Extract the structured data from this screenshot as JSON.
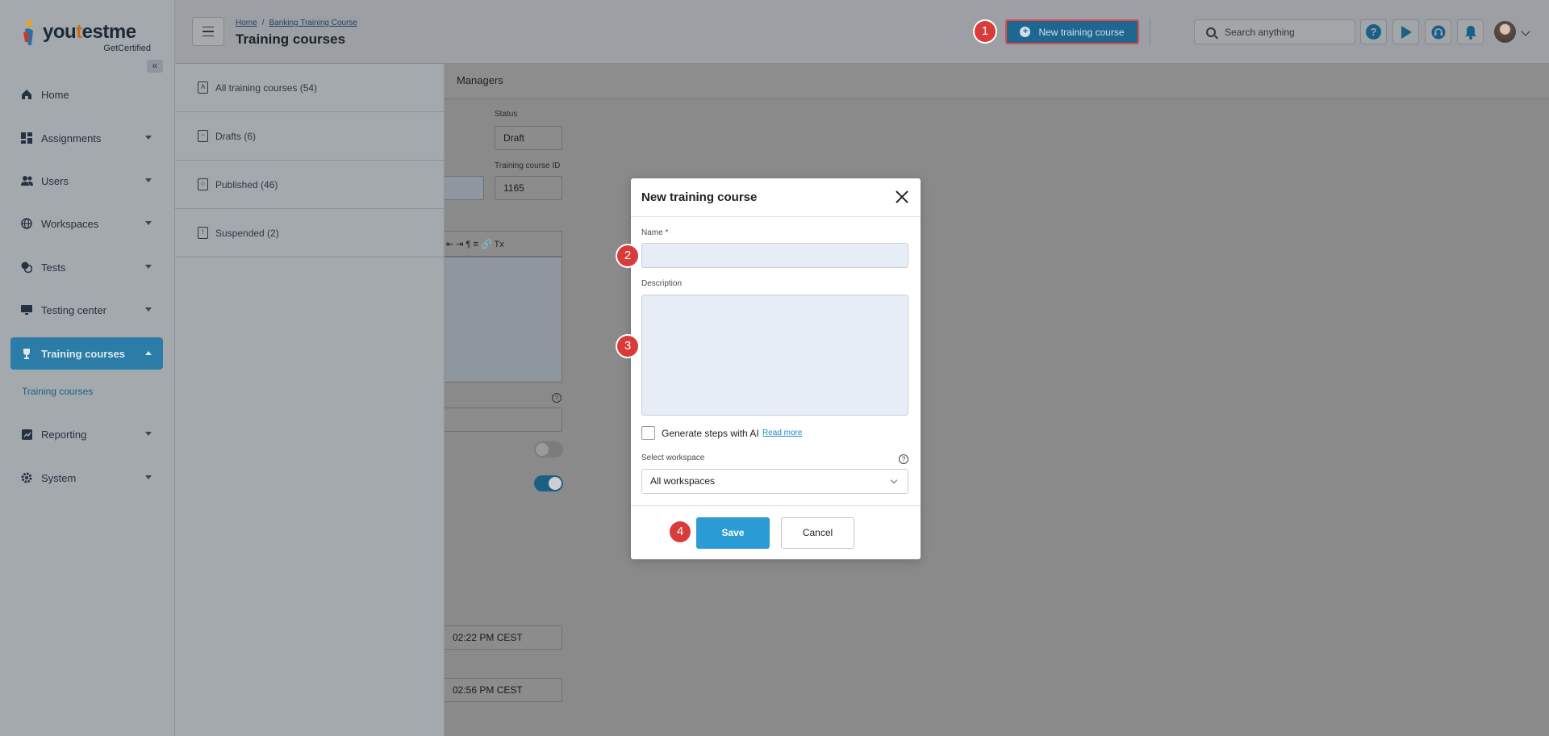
{
  "brand": {
    "name_part1": "you",
    "name_part2": "t",
    "name_part3": "estme",
    "tagline": "GetCertified"
  },
  "sidebar": {
    "collapse_glyph": "«",
    "items": [
      {
        "label": "Home",
        "icon": "home-icon"
      },
      {
        "label": "Assignments",
        "icon": "dashboard-icon"
      },
      {
        "label": "Users",
        "icon": "users-icon"
      },
      {
        "label": "Workspaces",
        "icon": "globe-icon"
      },
      {
        "label": "Tests",
        "icon": "tests-icon"
      },
      {
        "label": "Testing center",
        "icon": "monitor-icon"
      },
      {
        "label": "Training courses",
        "icon": "trophy-icon"
      },
      {
        "label": "Reporting",
        "icon": "chart-icon"
      },
      {
        "label": "System",
        "icon": "gear-icon"
      }
    ],
    "sub_item": "Training courses"
  },
  "header": {
    "breadcrumb_home": "Home",
    "breadcrumb_sep": "/",
    "breadcrumb_course": "Banking Training Course",
    "title": "Training courses",
    "new_button": "New training course",
    "search_placeholder": "Search anything",
    "help_glyph": "?"
  },
  "panel": {
    "items": [
      {
        "label": "All training courses (54)",
        "glyph": "A"
      },
      {
        "label": "Drafts (6)",
        "glyph": "~"
      },
      {
        "label": "Published (46)",
        "glyph": "☆"
      },
      {
        "label": "Suspended (2)",
        "glyph": "!"
      }
    ]
  },
  "background": {
    "tab_managers": "Managers",
    "status_label": "Status",
    "status_value": "Draft",
    "course_id_label": "Training course ID",
    "course_id_value": "1165",
    "date1": "02:22 PM CEST",
    "date2": "02:56 PM CEST",
    "toolbar_glyphs": "⇤ ⇥ ¶ ≡ 🔗 Tx",
    "help_glyph": "?"
  },
  "modal": {
    "title": "New training course",
    "name_label": "Name *",
    "name_value": "",
    "description_label": "Description",
    "description_value": "",
    "ai_checkbox_label": "Generate steps with AI",
    "read_more": "Read more",
    "workspace_label": "Select workspace",
    "workspace_value": "All workspaces",
    "info_glyph": "?",
    "save": "Save",
    "cancel": "Cancel"
  },
  "annotations": [
    "1",
    "2",
    "3",
    "4"
  ],
  "colors": {
    "accent": "#2b9bd6",
    "badge": "#d93a3a",
    "active_nav": "#2b7da8"
  }
}
